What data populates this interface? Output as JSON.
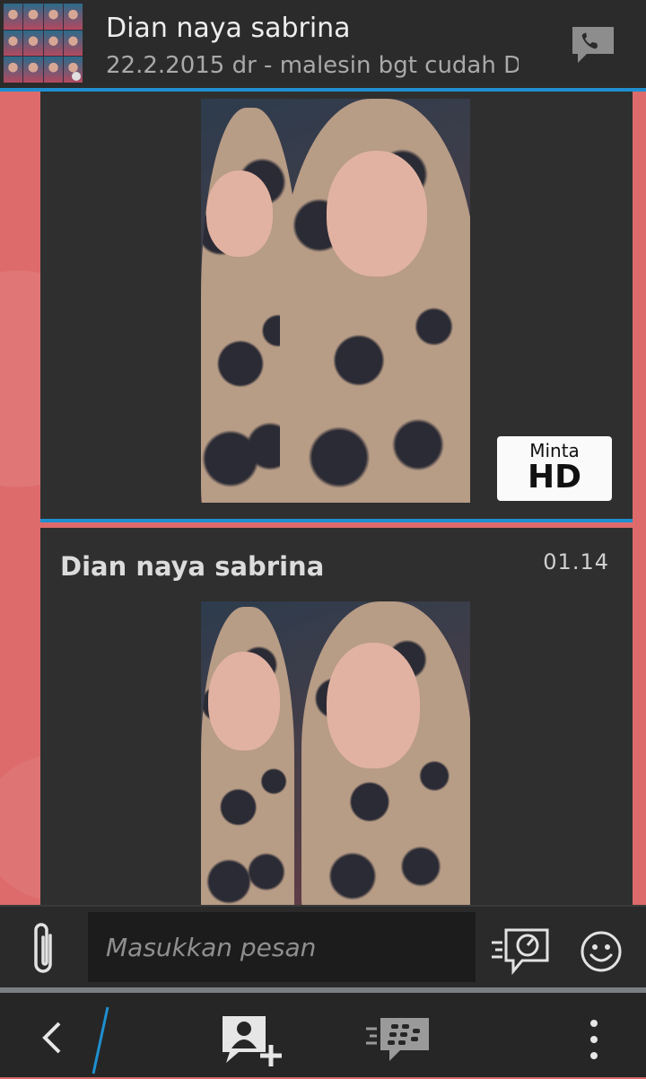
{
  "header": {
    "contact_name": "Dian naya sabrina",
    "status_message": "22.2.2015 dr - malesin bgt cudah D"
  },
  "messages": [
    {
      "type": "image",
      "hd_button": {
        "line1": "Minta",
        "line2": "HD"
      }
    },
    {
      "type": "image",
      "sender": "Dian naya sabrina",
      "time": "01.14"
    }
  ],
  "composer": {
    "placeholder": "Masukkan pesan"
  },
  "icons": {
    "header": [
      "phone-icon"
    ],
    "composer": [
      "paperclip-icon",
      "ping-icon",
      "emoji-icon"
    ],
    "action_bar": [
      "back-icon",
      "add-contact-icon",
      "bbm-icon",
      "more-icon"
    ]
  },
  "colors": {
    "accent": "#1e8fcf",
    "background": "#dd6b6b",
    "bubble": "#2f2f2f"
  }
}
